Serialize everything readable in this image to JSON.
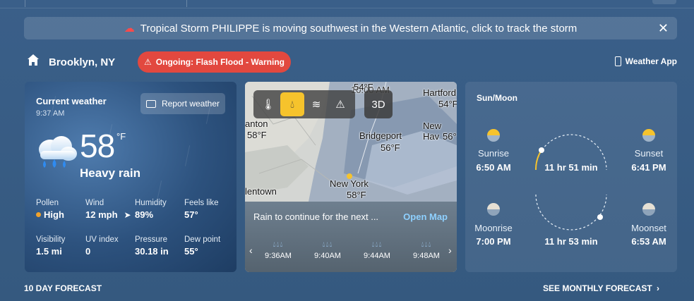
{
  "alert": {
    "text": "Tropical Storm PHILIPPE is moving southwest in the Western Atlantic, click to track the storm",
    "icon": "storm-icon",
    "icon_color": "#ff4a4a"
  },
  "location": {
    "name": "Brooklyn, NY",
    "warning": "Ongoing: Flash Flood - Warning",
    "warning_color": "#e2483f",
    "app_link": "Weather App"
  },
  "current": {
    "title": "Current weather",
    "time": "9:37 AM",
    "report_label": "Report weather",
    "temperature": "58",
    "unit": "°F",
    "condition": "Heavy rain",
    "details": [
      {
        "label": "Pollen",
        "value": "High"
      },
      {
        "label": "Wind",
        "value": "12 mph"
      },
      {
        "label": "Humidity",
        "value": "89%"
      },
      {
        "label": "Feels like",
        "value": "57°"
      },
      {
        "label": "Visibility",
        "value": "1.5 mi"
      },
      {
        "label": "UV index",
        "value": "0"
      },
      {
        "label": "Pressure",
        "value": "30.18 in"
      },
      {
        "label": "Dew point",
        "value": "55°"
      }
    ]
  },
  "map": {
    "labels": {
      "hartford": "Hartford",
      "hartford_temp": "54°F",
      "top_temp": "54°F",
      "clinton": "anton",
      "clinton_temp": "58°F",
      "bridgeport": "Bridgeport",
      "bridgeport_temp": "56°F",
      "newhaven": "New Hav",
      "newhaven_temp": "56°",
      "newyork": "New York",
      "newyork_temp": "58°F",
      "allentown": "lentown",
      "clock": "10:00 AM"
    },
    "toolbar_3d": "3D",
    "message": "Rain to continue for the next ...",
    "open_label": "Open Map",
    "timeline": [
      {
        "time": "9:36AM"
      },
      {
        "time": "9:40AM"
      },
      {
        "time": "9:44AM"
      },
      {
        "time": "9:48AM"
      }
    ]
  },
  "sunmoon": {
    "title": "Sun/Moon",
    "sunrise_label": "Sunrise",
    "sunrise_time": "6:50 AM",
    "sunset_label": "Sunset",
    "sunset_time": "6:41 PM",
    "sun_duration": "11 hr 51 min",
    "moonrise_label": "Moonrise",
    "moonrise_time": "7:00 PM",
    "moonset_label": "Moonset",
    "moonset_time": "6:53 AM",
    "moon_duration": "11 hr 53 min"
  },
  "footer": {
    "forecast": "10 DAY FORECAST",
    "monthly": "SEE MONTHLY FORECAST"
  }
}
